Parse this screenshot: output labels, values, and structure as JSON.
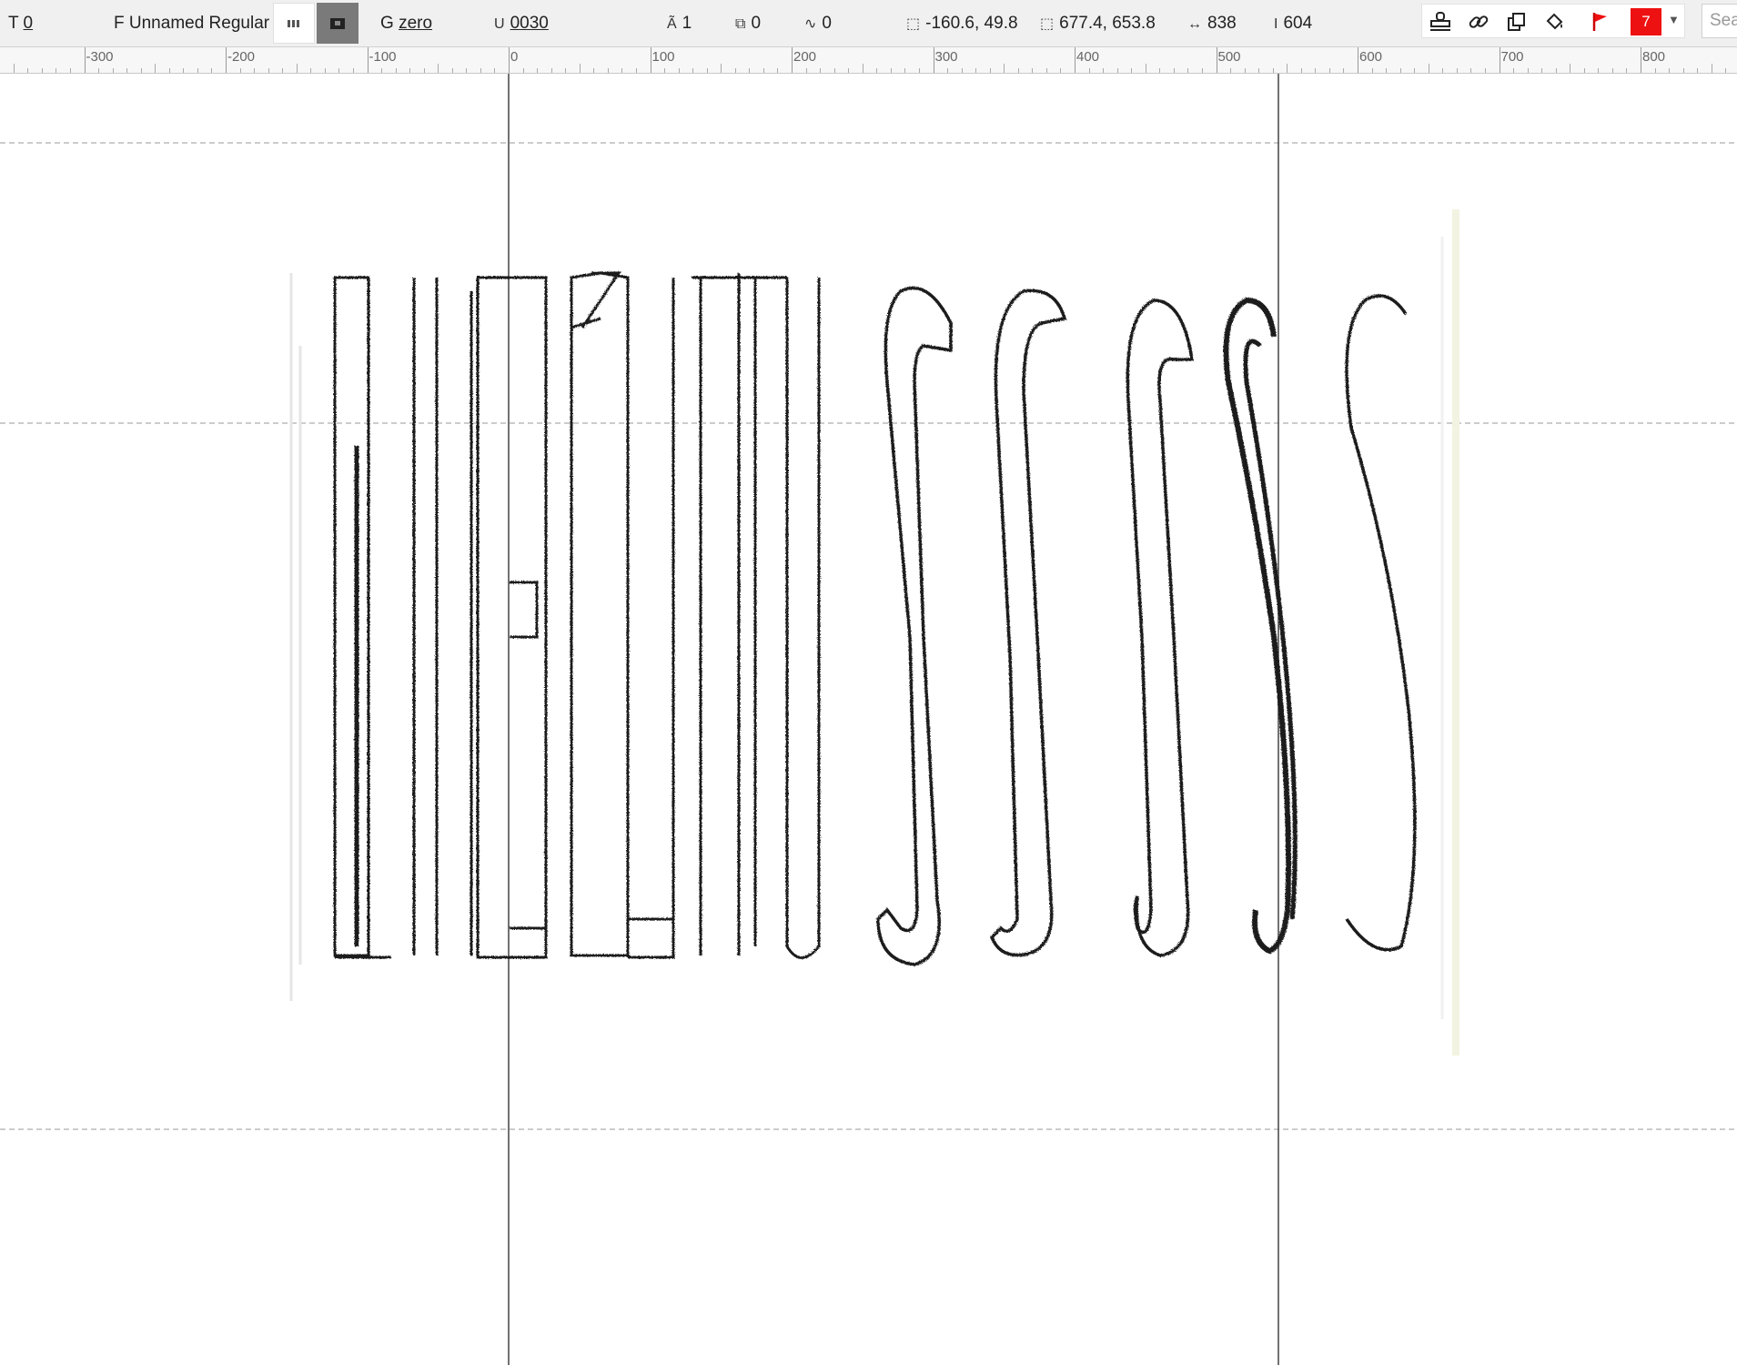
{
  "toolbar": {
    "tab_value": "0",
    "font_name": "Unnamed Regular",
    "glyph_name": "zero",
    "unicode": "0030",
    "layer_count": "1",
    "component_count": "0",
    "anchor_count": "0",
    "bbox_min": "-160.6, 49.8",
    "bbox_max": "677.4, 653.8",
    "width_value": "838",
    "height_value": "604",
    "flag_count": "7",
    "search_placeholder": "Sea",
    "labels": {
      "tab": "T",
      "font": "F",
      "glyph": "G"
    }
  },
  "ruler": {
    "labels": [
      "-300",
      "-200",
      "-100",
      "0",
      "100",
      "200",
      "300",
      "400",
      "500",
      "600",
      "700",
      "800"
    ]
  },
  "icons": {
    "view_metrics": "metrics-view-icon",
    "view_outline": "outline-view-icon",
    "unicode": "unicode-icon",
    "layers": "layers-icon",
    "components": "components-icon",
    "anchors": "anchors-icon",
    "bbox_min": "bbox-min-icon",
    "bbox_max": "bbox-max-icon",
    "width": "width-icon",
    "height": "height-icon",
    "stamp": "stamp-icon",
    "link": "link-icon",
    "copy": "copy-icon",
    "paint": "paint-bucket-icon",
    "flag": "flag-icon"
  },
  "colors": {
    "flag_red": "#ee1111",
    "toolbar_bg": "#f0f0f0"
  }
}
